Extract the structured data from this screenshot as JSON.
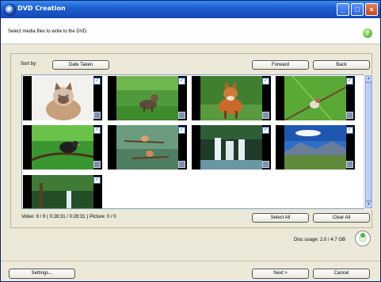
{
  "window": {
    "title": "DVD Creation"
  },
  "header": {
    "instruction": "Select media files to write to the DVD.",
    "help_label": "?"
  },
  "sort": {
    "label": "Sort by:",
    "option": "Date Taken"
  },
  "nav": {
    "forward": "Forward",
    "back": "Back"
  },
  "thumbnails": [
    {
      "subject": "cat"
    },
    {
      "subject": "kitten-in-grass"
    },
    {
      "subject": "fox"
    },
    {
      "subject": "bird-on-branch"
    },
    {
      "subject": "blackbird-on-branch"
    },
    {
      "subject": "birds-on-twigs"
    },
    {
      "subject": "waterfall"
    },
    {
      "subject": "mountain-landscape"
    },
    {
      "subject": "forest-waterfall"
    }
  ],
  "selection": {
    "select_all": "Select All",
    "clear_all": "Clear All"
  },
  "status": "Video: 9 / 9 ( 0:28:31 / 0:28:31 ) Picture: 0 / 0",
  "disc_usage": "Disc usage: 2.0 / 4.7 GB",
  "footer": {
    "settings": "Settings...",
    "next": "Next >",
    "cancel": "Cancel"
  },
  "colors": {
    "titlebar": "#1d5fd1",
    "body": "#ece9d8",
    "accent": "#1d4aa6"
  }
}
